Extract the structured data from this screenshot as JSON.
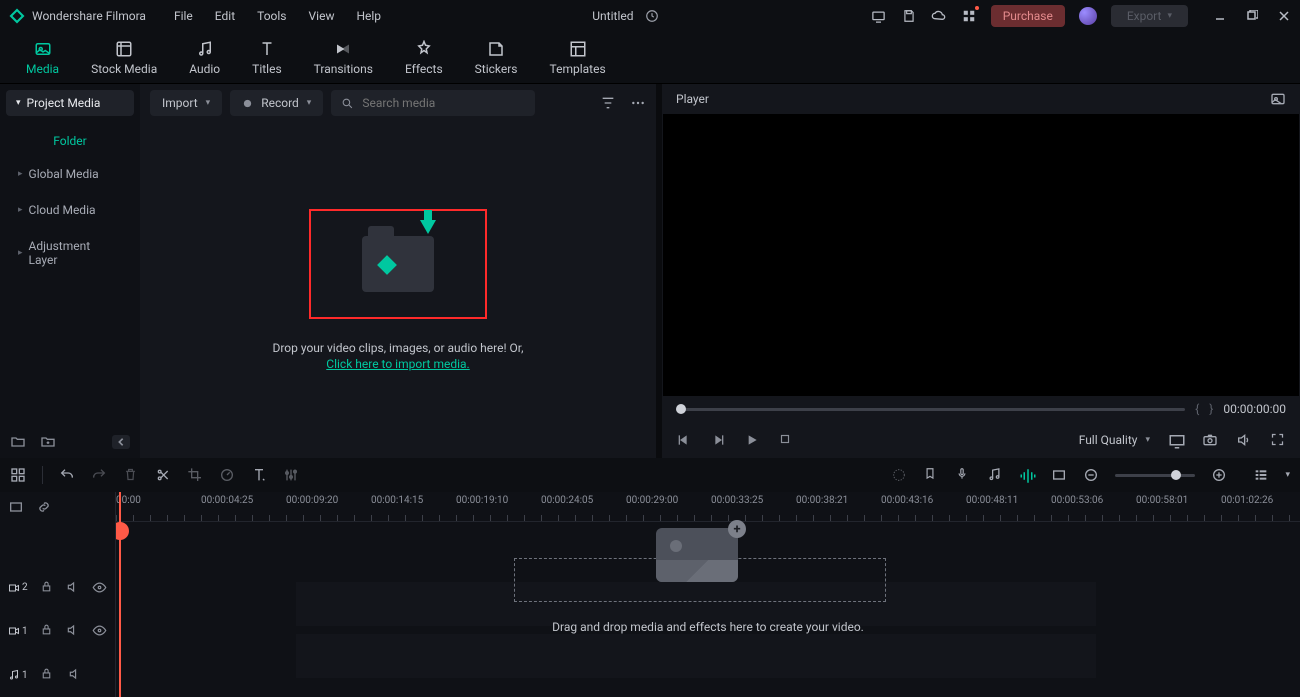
{
  "app_name": "Wondershare Filmora",
  "menu": [
    "File",
    "Edit",
    "Tools",
    "View",
    "Help"
  ],
  "doc_title": "Untitled",
  "purchase": "Purchase",
  "export": "Export",
  "tabs": [
    {
      "label": "Media"
    },
    {
      "label": "Stock Media"
    },
    {
      "label": "Audio"
    },
    {
      "label": "Titles"
    },
    {
      "label": "Transitions"
    },
    {
      "label": "Effects"
    },
    {
      "label": "Stickers"
    },
    {
      "label": "Templates"
    }
  ],
  "sidebar": {
    "heading": "Project Media",
    "folder": "Folder",
    "items": [
      "Global Media",
      "Cloud Media",
      "Adjustment Layer"
    ]
  },
  "toolbar": {
    "import": "Import",
    "record": "Record",
    "search_placeholder": "Search media"
  },
  "dropzone": {
    "text": "Drop your video clips, images, or audio here! Or,",
    "link": "Click here to import media."
  },
  "player": {
    "title": "Player",
    "time": "00:00:00:00",
    "quality": "Full Quality"
  },
  "ruler": [
    "00:00",
    "00:00:04:25",
    "00:00:09:20",
    "00:00:14:15",
    "00:00:19:10",
    "00:00:24:05",
    "00:00:29:00",
    "00:00:33:25",
    "00:00:38:21",
    "00:00:43:16",
    "00:00:48:11",
    "00:00:53:06",
    "00:00:58:01",
    "00:01:02:26"
  ],
  "timeline_msg": "Drag and drop media and effects here to create your video.",
  "tracks": [
    {
      "type": "video",
      "n": "2"
    },
    {
      "type": "video",
      "n": "1"
    },
    {
      "type": "audio",
      "n": "1"
    }
  ]
}
